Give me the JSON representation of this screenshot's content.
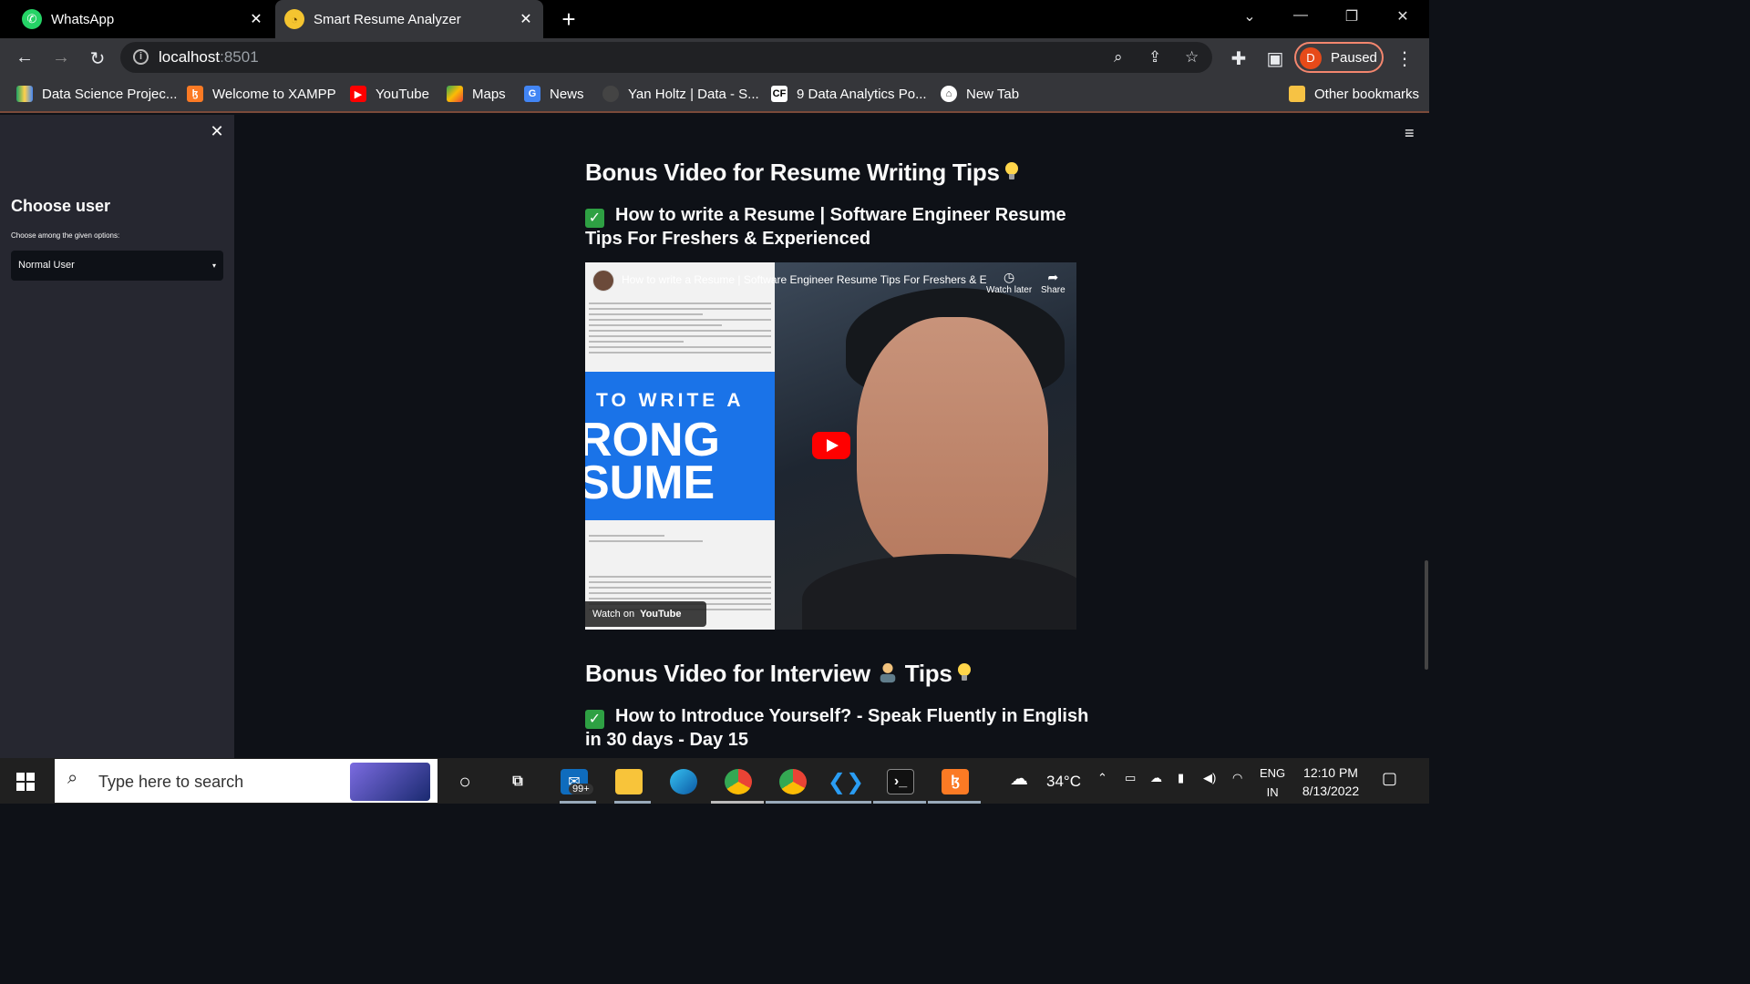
{
  "browser": {
    "tabs": [
      {
        "label": "WhatsApp",
        "active": false
      },
      {
        "label": "Smart Resume Analyzer",
        "active": true
      }
    ],
    "url_host": "localhost",
    "url_port": ":8501",
    "profile_initial": "D",
    "profile_status": "Paused",
    "bookmarks": [
      {
        "label": "Data Science Projec..."
      },
      {
        "label": "Welcome to XAMPP"
      },
      {
        "label": "YouTube"
      },
      {
        "label": "Maps"
      },
      {
        "label": "News"
      },
      {
        "label": "Yan Holtz | Data - S..."
      },
      {
        "label": "9 Data Analytics Po..."
      },
      {
        "label": "New Tab"
      },
      {
        "label": "Other bookmarks"
      }
    ]
  },
  "sidebar": {
    "heading": "Choose user",
    "label": "Choose among the given options:",
    "selected": "Normal User"
  },
  "main": {
    "section1_title": "Bonus Video for Resume Writing Tips",
    "video1_title": "How to write a Resume | Software Engineer Resume Tips For Freshers & Experienced",
    "video1": {
      "overlay_title": "How to write a Resume | Software Engineer Resume Tips For Freshers & Experi...",
      "watch_later": "Watch later",
      "share": "Share",
      "thumb_line1": "TO WRITE A",
      "thumb_line2": "RONG",
      "thumb_line3": "SUME",
      "watch_on": "Watch on",
      "youtube": "YouTube"
    },
    "section2_title_a": "Bonus Video for Interview",
    "section2_title_b": "Tips",
    "video2_title": "How to Introduce Yourself? - Speak Fluently in English in 30 days - Day 15"
  },
  "taskbar": {
    "search_placeholder": "Type here to search",
    "mail_badge": "99+",
    "weather": "34°C",
    "lang1": "ENG",
    "lang2": "IN",
    "time": "12:10 PM",
    "date": "8/13/2022"
  },
  "colors": {
    "app_bg": "#0e1117",
    "sidebar_bg": "#262730",
    "check_green": "#2ea043",
    "youtube_red": "#ff0000"
  }
}
